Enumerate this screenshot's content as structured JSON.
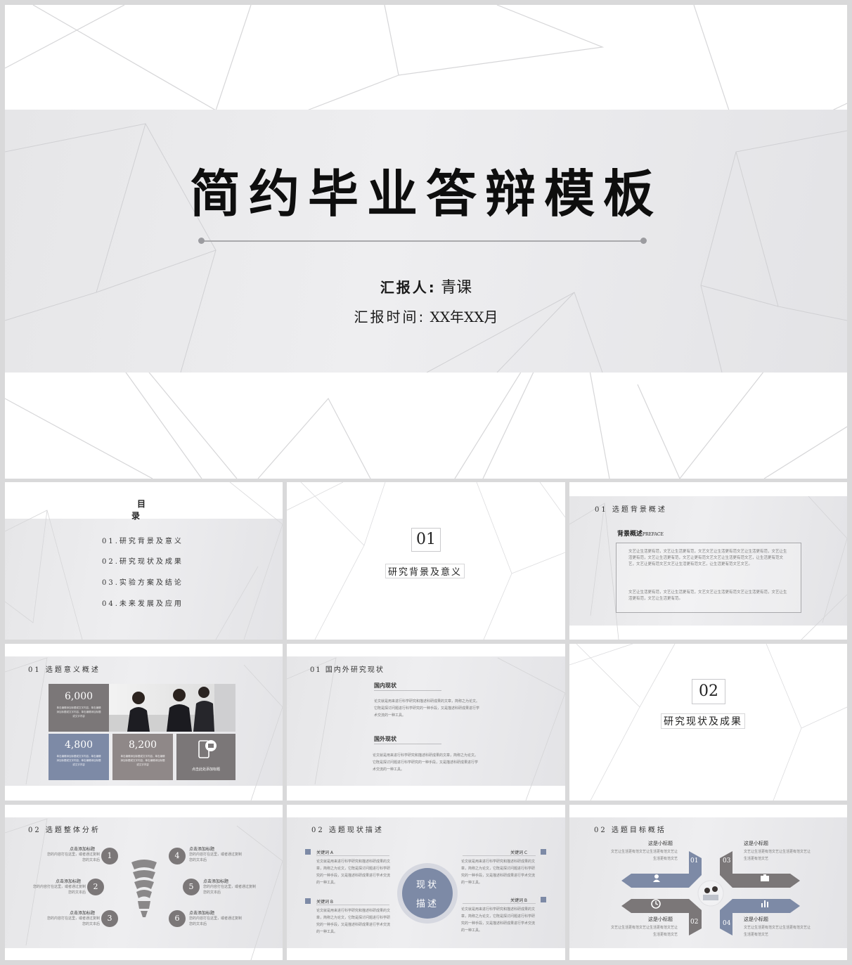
{
  "cover": {
    "title": "简约毕业答辩模板",
    "reporter_label": "汇报人:",
    "reporter_name": "青课",
    "time_label": "汇报时间:",
    "time_value": "XX年XX月"
  },
  "toc": {
    "title_line1": "目",
    "title_line2": "录",
    "items": [
      {
        "num": "01.",
        "label": "研究背景及意义"
      },
      {
        "num": "02.",
        "label": "研究现状及成果"
      },
      {
        "num": "03.",
        "label": "实验方案及结论"
      },
      {
        "num": "04.",
        "label": "未来发展及应用"
      }
    ]
  },
  "section01": {
    "num": "01",
    "label": "研究背景及意义"
  },
  "background": {
    "header_num": "01",
    "header": "选题背景概述",
    "subtitle": "背景概述",
    "subtitle_en": "PREFACE",
    "para1": "文艺让生活更有范，文艺让生活更有范，文艺文艺让生活更有范文艺让生活更有范，文艺让生活更有范，文艺让生活更有范，文艺让更有范文艺文艺让生活更有范文艺，让生活更有范文艺，文艺让更有范文艺文艺让生活更有范文艺，让生活更有范文艺文艺。",
    "para2": "文艺让生活更有范，文艺让生活更有范，文艺文艺让生活更有范文艺让生活更有范，文艺让生活更有范，文艺让生活更有范。"
  },
  "significance": {
    "header_num": "01",
    "header": "选题意义概述",
    "stat1": "6,000",
    "stat2": "4,800",
    "stat3": "8,200",
    "stat_desc": "单击编辑添加标题或文字内容，单击编辑添加标题或文字内容，单击编辑添加标题或文字内容",
    "icon_caption": "点击此处添加标题"
  },
  "domestic": {
    "header_num": "01",
    "header": "国内外研究现状",
    "sub1": "国内现状",
    "para1": "论文就是用来进行科学研究和描述科研成果的文章，简称之为论文。它既是探讨问题进行科学研究的一种手段，又是描述科研成果进行学术交流的一种工具。",
    "sub2": "国外现状",
    "para2": "论文就是用来进行科学研究和描述科研成果的文章，简称之为论文。它既是探讨问题进行科学研究的一种手段，又是描述科研成果进行学术交流的一种工具。"
  },
  "section02": {
    "num": "02",
    "label": "研究现状及成果"
  },
  "overall": {
    "header_num": "02",
    "header": "选题整体分析",
    "items": [
      {
        "n": "1",
        "title": "点击添加标题",
        "desc": "您的内容打在这里，或者通过复制您的文本后"
      },
      {
        "n": "2",
        "title": "点击添加标题",
        "desc": "您的内容打在这里，或者通过复制您的文本后"
      },
      {
        "n": "3",
        "title": "点击添加标题",
        "desc": "您的内容打在这里，或者通过复制您的文本后"
      },
      {
        "n": "4",
        "title": "点击添加标题",
        "desc": "您的内容打在这里，或者通过复制您的文本后"
      },
      {
        "n": "5",
        "title": "点击添加标题",
        "desc": "您的内容打在这里，或者通过复制您的文本后"
      },
      {
        "n": "6",
        "title": "点击添加标题",
        "desc": "您的内容打在这里，或者通过复制您的文本后"
      }
    ]
  },
  "status": {
    "header_num": "02",
    "header": "选题现状描述",
    "center1": "现状",
    "center2": "描述",
    "kw_a": "关键词 A",
    "kw_b": "关键词 B",
    "kw_c": "关键词 C",
    "kw_d": "关键词 B",
    "para": "论文就是用来进行科学研究和描述科研成果的文章，简称之为论文，它既是探讨问题进行科学研究的一种手段，又是描述科研成果进行学术交流的一种工具。"
  },
  "goals": {
    "header_num": "02",
    "header": "选题目标概括",
    "title": "这是小标题",
    "desc": "文艺让生活更有范文艺让生活更有范文艺让生活更有范文艺",
    "n1": "01",
    "n2": "02",
    "n3": "03",
    "n4": "04"
  },
  "colors": {
    "blue": "#7d8aa6",
    "gray": "#7b7778",
    "taupe": "#8f8888",
    "dark": "#1a1a1a"
  },
  "icons": [
    "phone-chat-icon",
    "lightbulb-icon",
    "user-icon",
    "briefcase-icon",
    "clock-icon",
    "bar-chart-icon"
  ]
}
